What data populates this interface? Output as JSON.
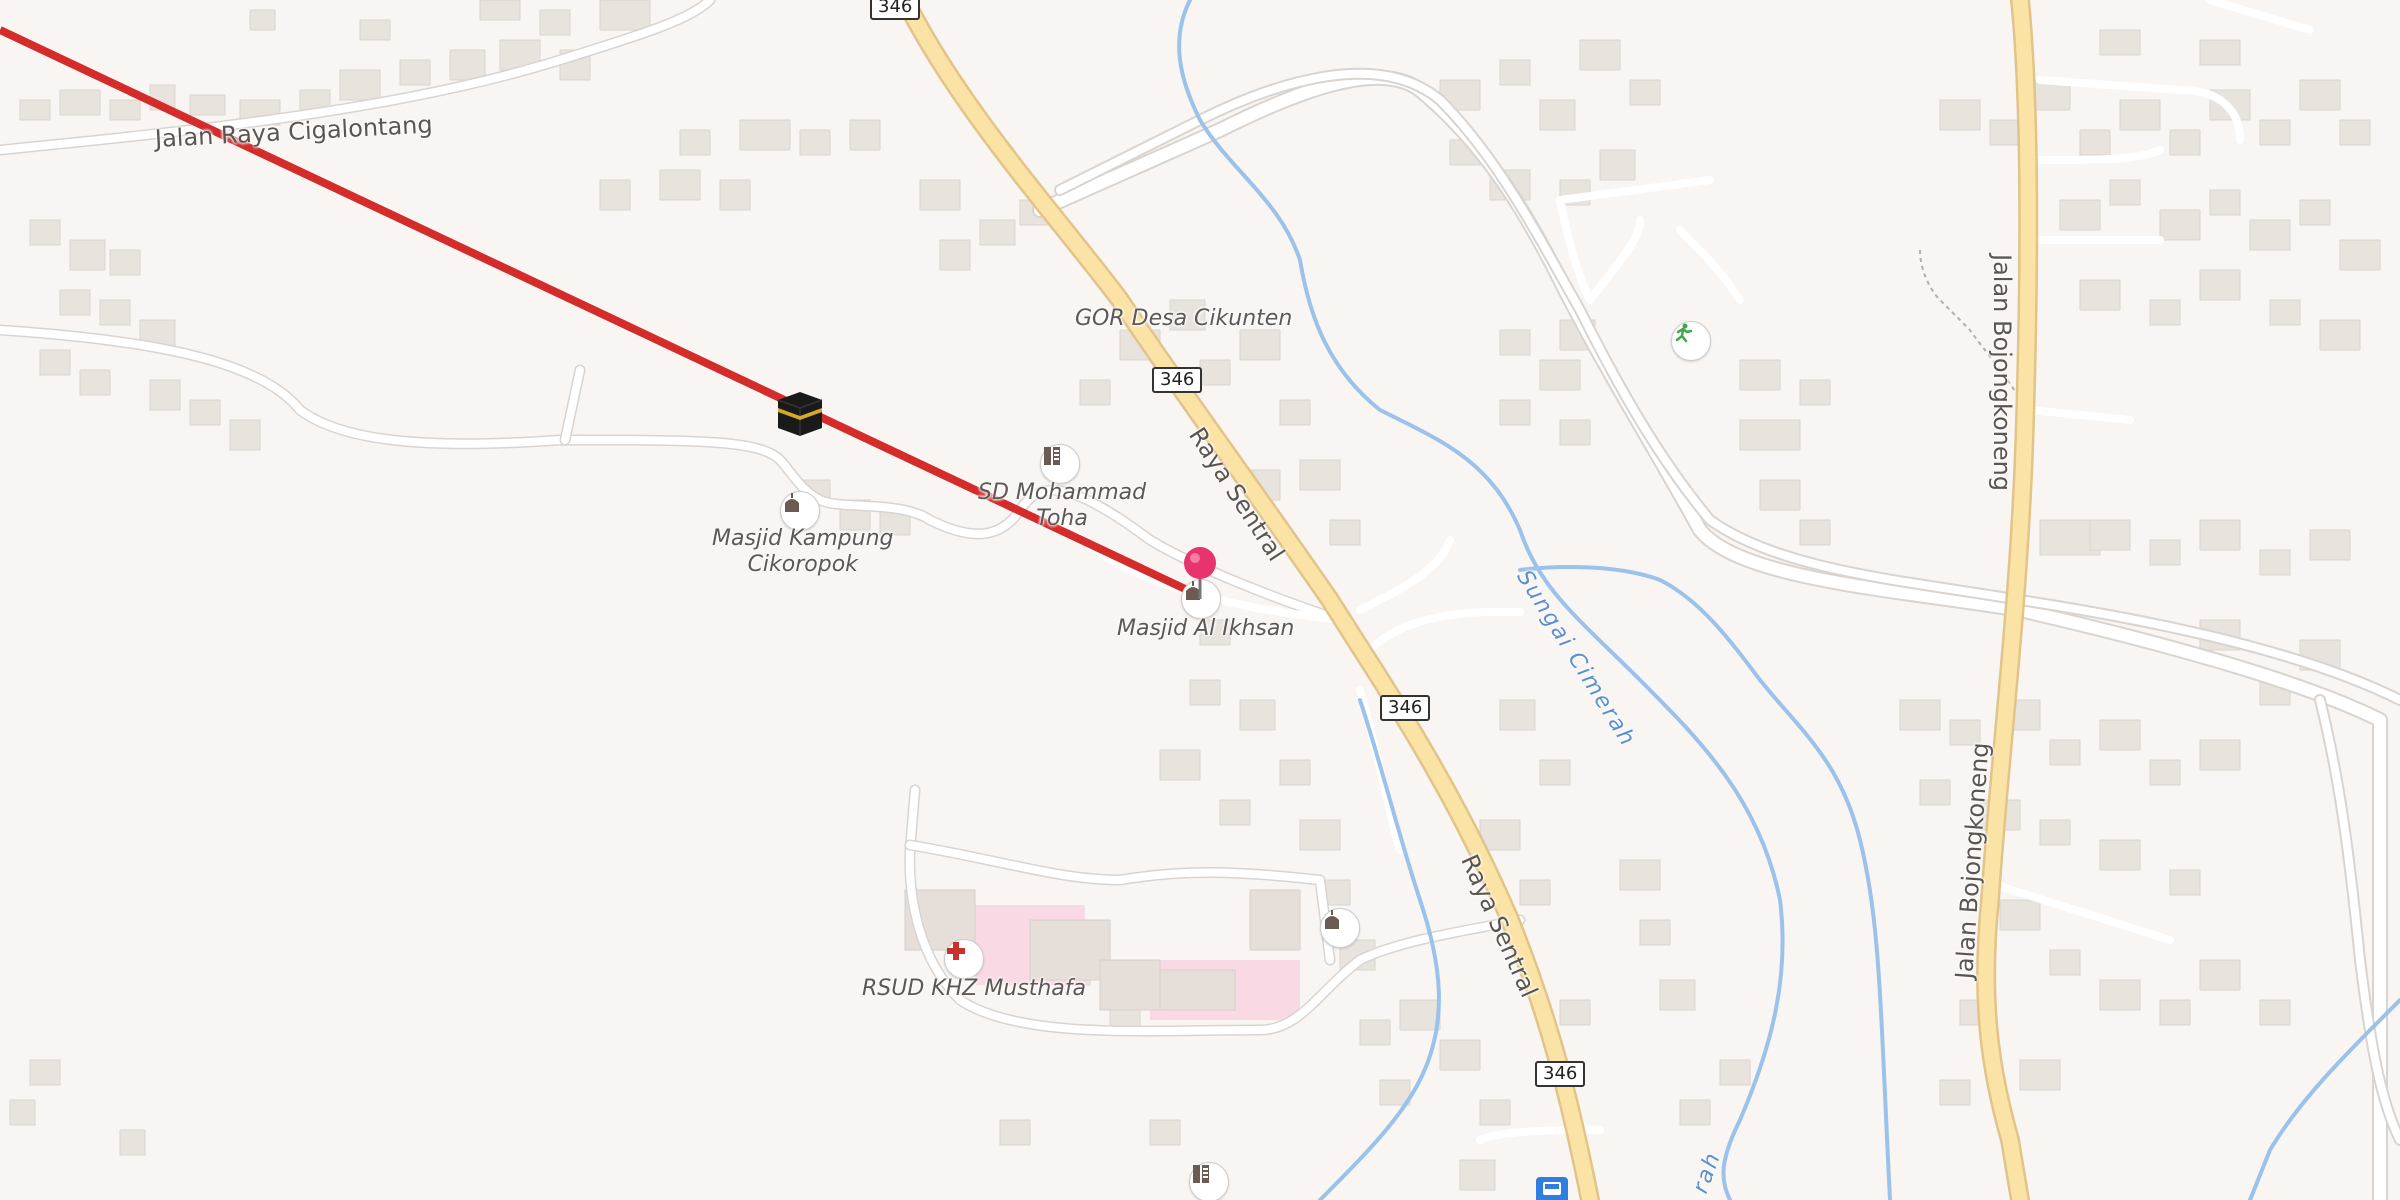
{
  "roads": {
    "raya_sentral_1": "Raya Sentral",
    "raya_sentral_2": "Raya Sentral",
    "cigalontang": "Jalan Raya Cigalontang",
    "bojongkoneng_1": "Jalan Bojongkoneng",
    "bojongkoneng_2": "Jalan Bojongkoneng"
  },
  "route_shields": [
    "346",
    "346",
    "346",
    "346"
  ],
  "river": {
    "name": "Sungai Cimerah",
    "name_partial": "rah"
  },
  "places": {
    "gor": "GOR Desa Cikunten",
    "sd": "SD Mohammad\nToha",
    "masjid_kampung": "Masjid Kampung\nCikoropok",
    "masjid_ikhsan": "Masjid Al Ikhsan",
    "rsud": "RSUD KHZ Musthafa"
  },
  "qibla_line_color": "#d42b2b",
  "pin_color": "#e8336d",
  "icons": [
    "kaaba-icon",
    "school-icon",
    "mosque-icon",
    "hospital-icon",
    "sports-icon",
    "bus-stop-icon",
    "pin-icon"
  ]
}
